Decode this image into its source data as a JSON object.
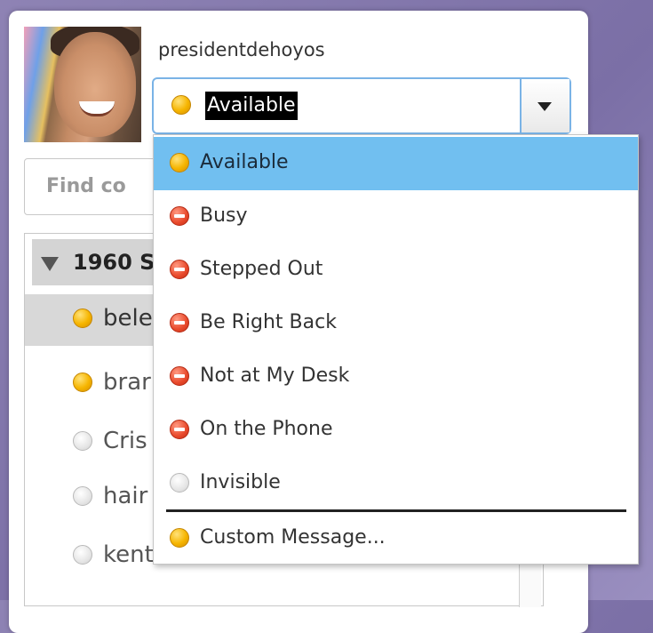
{
  "user": {
    "username": "presidentdehoyos"
  },
  "status": {
    "selected_label": "Available",
    "selected_icon": "available"
  },
  "search": {
    "placeholder_visible": "Find co"
  },
  "contacts": {
    "group": {
      "label": "1960 S"
    },
    "items": [
      {
        "label": "bele",
        "status": "available",
        "selected": true
      },
      {
        "label": "brar",
        "status": "available",
        "selected": false
      },
      {
        "label": "Cris",
        "status": "invisible",
        "selected": false
      },
      {
        "label": "hair",
        "status": "invisible",
        "selected": false
      },
      {
        "label": "kents",
        "status": "invisible",
        "selected": false
      }
    ]
  },
  "menu": {
    "items": [
      {
        "label": "Available",
        "icon": "available",
        "highlighted": true
      },
      {
        "label": "Busy",
        "icon": "busy"
      },
      {
        "label": "Stepped Out",
        "icon": "busy"
      },
      {
        "label": "Be Right Back",
        "icon": "busy"
      },
      {
        "label": "Not at My Desk",
        "icon": "busy"
      },
      {
        "label": "On the Phone",
        "icon": "busy"
      },
      {
        "label": "Invisible",
        "icon": "invisible"
      }
    ],
    "custom": {
      "label": "Custom Message...",
      "icon": "available"
    }
  },
  "colors": {
    "available": "#f6b500",
    "busy": "#e8492b",
    "invisible": "#e6e6e6",
    "highlight": "#71bff0",
    "select_border": "#7ab3e6"
  }
}
